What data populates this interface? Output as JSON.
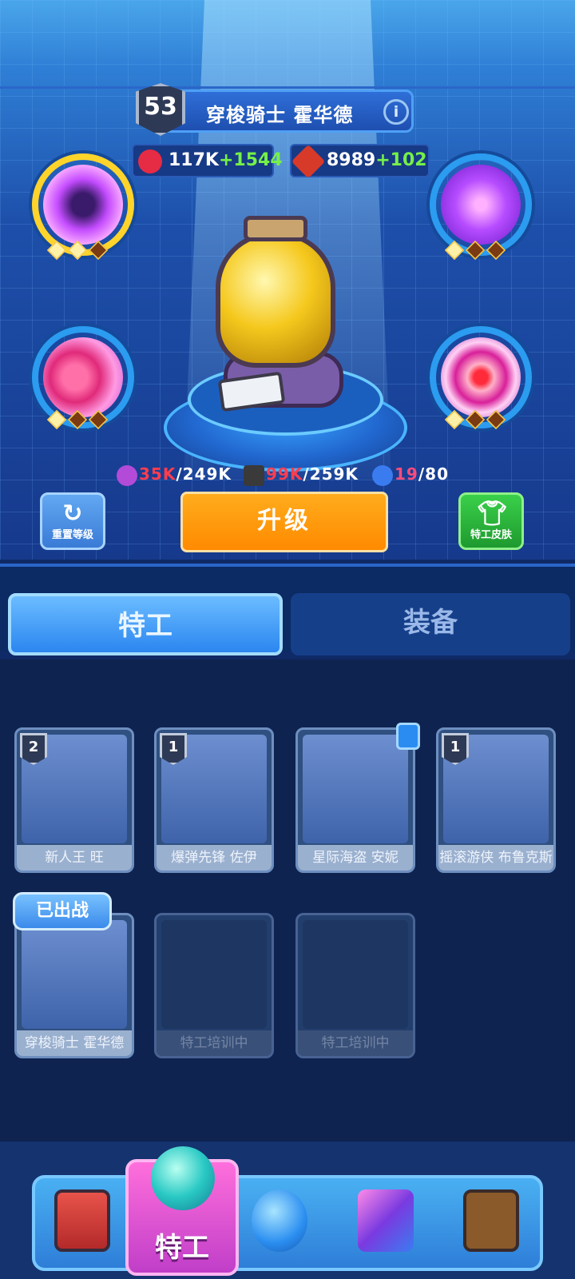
{
  "header": {
    "level": "53",
    "agent_name": "穿梭骑士 霍华德",
    "info_icon": "i",
    "hp": {
      "base": "117K",
      "bonus": "+1544"
    },
    "attack": {
      "base": "8989",
      "bonus": "+102"
    }
  },
  "resources": {
    "exp": {
      "current": "35K",
      "total": "/249K"
    },
    "tickets": {
      "current": "99K",
      "total": "/259K"
    },
    "parts": {
      "current": "19",
      "total": "/80"
    }
  },
  "buttons": {
    "reset_level": "重置等级",
    "upgrade": "升级",
    "agent_skin": "特工皮肤"
  },
  "tabs": [
    {
      "label": "特工",
      "active": true
    },
    {
      "label": "装备",
      "active": false
    }
  ],
  "agents": [
    {
      "name": "新人王 旺",
      "rank": "2"
    },
    {
      "name": "爆弹先锋 佐伊",
      "rank": "1"
    },
    {
      "name": "星际海盗 安妮",
      "rank": "",
      "locked": true
    },
    {
      "name": "摇滚游侠 布鲁克斯",
      "rank": "1"
    },
    {
      "name": "穿梭骑士 霍华德",
      "rank": "",
      "deployed": true
    },
    {
      "name": "特工培训中",
      "rank": ""
    },
    {
      "name": "特工培训中",
      "rank": ""
    }
  ],
  "deployed_label": "已出战",
  "bottom_nav": {
    "active_label": "特工",
    "items": [
      "shop-icon",
      "agent-icon",
      "planet-icon",
      "cube-icon",
      "gem-icon"
    ]
  },
  "colors": {
    "accent_orange": "#ff8a00",
    "bonus_green": "#76f048",
    "current_red": "#ff3d4e",
    "active_tab": "#2b86f0"
  }
}
